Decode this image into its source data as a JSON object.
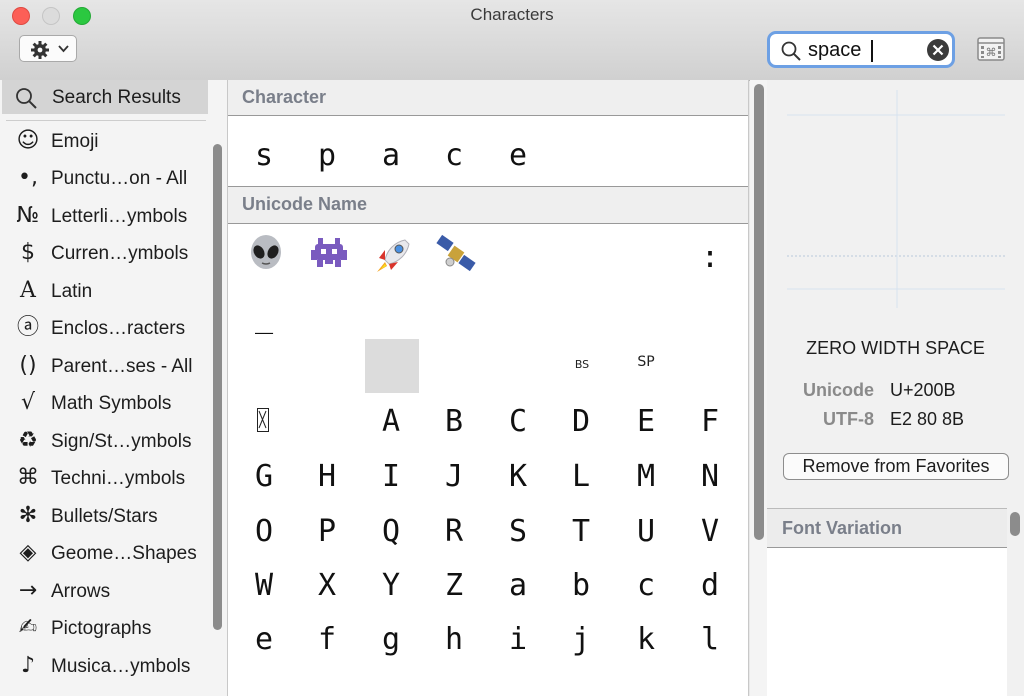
{
  "window": {
    "title": "Characters"
  },
  "search": {
    "value": "space"
  },
  "sidebar": {
    "search_results": "Search Results",
    "categories": [
      {
        "icon": "☺",
        "icon_name": "smiley-icon",
        "label": "Emoji"
      },
      {
        "icon": "•,",
        "icon_name": "punctuation-icon",
        "label": "Punctu…on - All"
      },
      {
        "icon": "№",
        "icon_name": "numero-icon",
        "label": "Letterli…ymbols"
      },
      {
        "icon": "$",
        "icon_name": "dollar-icon",
        "label": "Curren…ymbols"
      },
      {
        "icon": "A",
        "icon_name": "latin-a-icon",
        "label": "Latin"
      },
      {
        "icon": "ⓐ",
        "icon_name": "circled-a-icon",
        "label": "Enclos…racters"
      },
      {
        "icon": "()",
        "icon_name": "parentheses-icon",
        "label": "Parent…ses - All"
      },
      {
        "icon": "√",
        "icon_name": "square-root-icon",
        "label": "Math Symbols"
      },
      {
        "icon": "♻",
        "icon_name": "recycle-icon",
        "label": "Sign/St…ymbols"
      },
      {
        "icon": "⌘",
        "icon_name": "command-icon",
        "label": "Techni…ymbols"
      },
      {
        "icon": "✻",
        "icon_name": "asterisk-star-icon",
        "label": "Bullets/Stars"
      },
      {
        "icon": "◈",
        "icon_name": "diamond-icon",
        "label": "Geome…Shapes"
      },
      {
        "icon": "→",
        "icon_name": "arrow-right-icon",
        "label": "Arrows"
      },
      {
        "icon": "✍",
        "icon_name": "writing-hand-icon",
        "label": "Pictographs"
      },
      {
        "icon": "♪",
        "icon_name": "music-note-icon",
        "label": "Musica…ymbols"
      }
    ]
  },
  "main": {
    "character_header": "Character",
    "character_row": [
      "s",
      "p",
      "a",
      "c",
      "e"
    ],
    "unicode_header": "Unicode Name",
    "emoji_row": [
      "alien-emoji",
      "space-invader-emoji",
      "rocket-emoji",
      "satellite-emoji"
    ],
    "colon": ":",
    "underscore": "_",
    "bs_label": "BS",
    "sp_label": "SP",
    "grid_rows": [
      [
        "",
        "",
        "A",
        "B",
        "C",
        "D",
        "E",
        "F"
      ],
      [
        "G",
        "H",
        "I",
        "J",
        "K",
        "L",
        "M",
        "N"
      ],
      [
        "O",
        "P",
        "Q",
        "R",
        "S",
        "T",
        "U",
        "V"
      ],
      [
        "W",
        "X",
        "Y",
        "Z",
        "a",
        "b",
        "c",
        "d"
      ],
      [
        "e",
        "f",
        "g",
        "h",
        "i",
        "j",
        "k",
        "l"
      ]
    ]
  },
  "detail": {
    "name": "ZERO WIDTH SPACE",
    "unicode_label": "Unicode",
    "unicode_value": "U+200B",
    "utf8_label": "UTF-8",
    "utf8_value": "E2 80 8B",
    "favorites_button": "Remove from Favorites",
    "font_variation": "Font Variation"
  }
}
